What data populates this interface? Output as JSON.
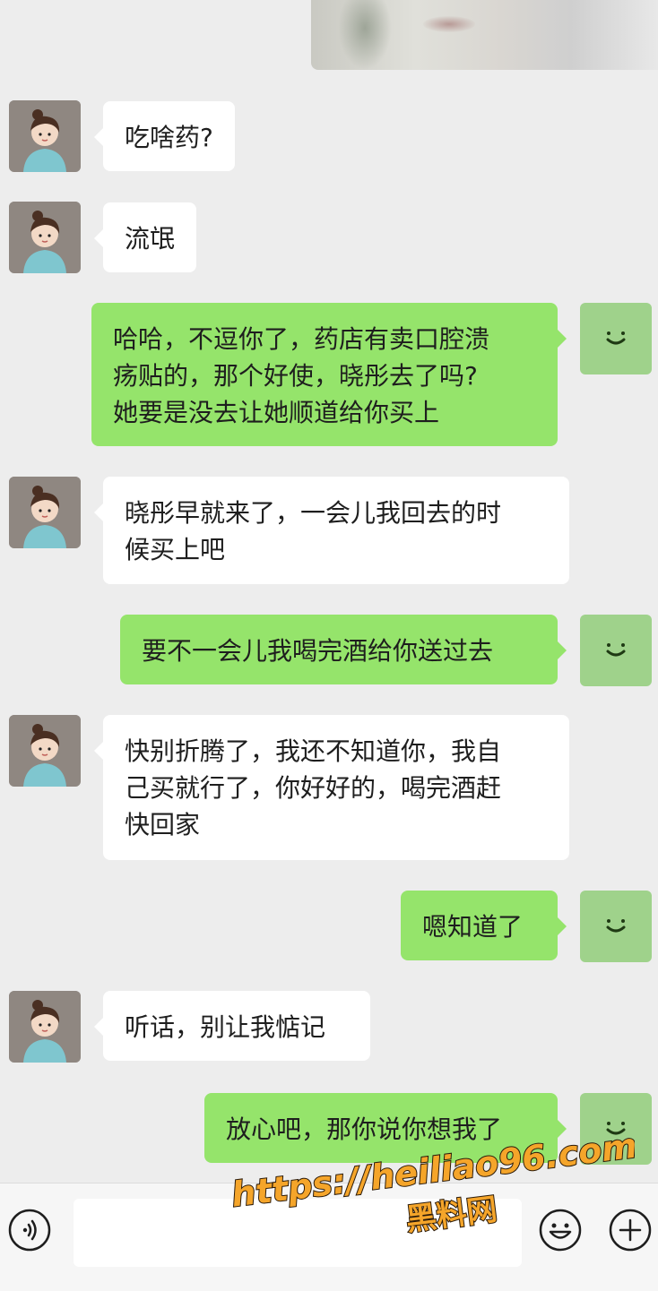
{
  "conversation": {
    "shared_image": "blurred-photo",
    "messages": [
      {
        "side": "in",
        "text": "吃啥药?"
      },
      {
        "side": "in",
        "text": "流氓"
      },
      {
        "side": "out",
        "lines": [
          "哈哈，不逗你了，药店有卖口腔溃",
          "疡贴的，那个好使，晓彤去了吗?",
          "她要是没去让她顺道给你买上"
        ]
      },
      {
        "side": "in",
        "lines": [
          "晓彤早就来了，一会儿我回去的时",
          "候买上吧"
        ]
      },
      {
        "side": "out",
        "text": "要不一会儿我喝完酒给你送过去"
      },
      {
        "side": "in",
        "lines": [
          "快别折腾了，我还不知道你，我自",
          "己买就行了，你好好的，喝完酒赶",
          "快回家"
        ]
      },
      {
        "side": "out",
        "text": "嗯知道了"
      },
      {
        "side": "in",
        "text": "听话，别让我惦记"
      },
      {
        "side": "out",
        "text": "放心吧，那你说你想我了"
      }
    ]
  },
  "input_bar": {
    "voice_icon": "voice-icon",
    "emoji_icon": "emoji-icon",
    "plus_icon": "plus-icon",
    "input_value": ""
  },
  "watermark": {
    "url": "https://heiliao96.com",
    "name": "黑料网",
    "fill": "#f5a52a",
    "stroke": "#2a1a0a"
  },
  "colors": {
    "background": "#ededed",
    "incoming_bubble": "#ffffff",
    "outgoing_bubble": "#95e46b",
    "my_avatar": "#9fd28b"
  }
}
